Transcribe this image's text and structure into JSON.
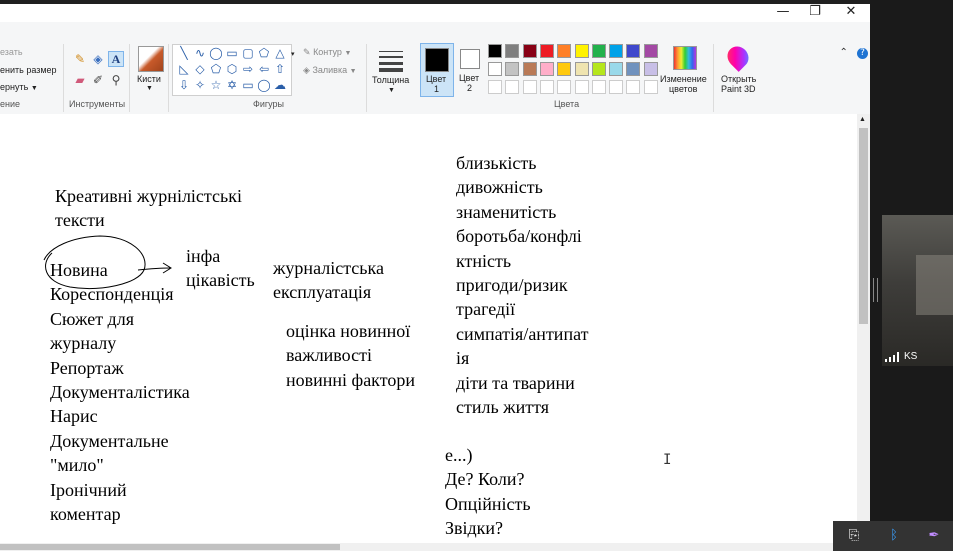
{
  "window": {
    "minimize_glyph": "—",
    "maximize_glyph": "❐",
    "close_glyph": "✕"
  },
  "ribbon": {
    "image_group": {
      "crop_label": "езать",
      "resize_label": "енить размер",
      "rotate_label": "ернуть",
      "group_label": "ение"
    },
    "tools_group": {
      "label": "Инструменты"
    },
    "brushes": {
      "label": "Кисти"
    },
    "shapes_group": {
      "label": "Фигуры",
      "outline_label": "Контур",
      "fill_label": "Заливка"
    },
    "size": {
      "label": "Толщина"
    },
    "colors": {
      "color1_label_a": "Цвет",
      "color1_label_b": "1",
      "color2_label_a": "Цвет",
      "color2_label_b": "2",
      "group_label": "Цвета",
      "color1": "#000000",
      "color2": "#ffffff",
      "palette_row1": [
        "#000000",
        "#7f7f7f",
        "#880015",
        "#ed1c24",
        "#ff7f27",
        "#fff200",
        "#22b14c",
        "#00a2e8",
        "#3f48cc",
        "#a349a4"
      ],
      "palette_row2": [
        "#ffffff",
        "#c3c3c3",
        "#b97a57",
        "#ffaec9",
        "#ffc90e",
        "#efe4b0",
        "#b5e61d",
        "#99d9ea",
        "#7092be",
        "#c8bfe7"
      ],
      "palette_row3": [
        "#ffffff",
        "#ffffff",
        "#ffffff",
        "#ffffff",
        "#ffffff",
        "#ffffff",
        "#ffffff",
        "#ffffff",
        "#ffffff",
        "#ffffff"
      ],
      "edit_colors_a": "Изменение",
      "edit_colors_b": "цветов"
    },
    "paint3d": {
      "label_a": "Открыть",
      "label_b": "Paint 3D"
    }
  },
  "canvas": {
    "heading": "Креативні журнілістські\nтексти",
    "genres": "Новина\nКореспонденція\nСюжет для\nжурналу\nРепортаж\nДокументалістика\nНарис\nДокументальне\n\"мило\"\nІронічний\nкоментар",
    "info_interest": "інфа\nцікавість",
    "exploitation": "журналістська\nексплуатація",
    "news_value": "оцінка новинної\nважливості\nновинні фактори",
    "factors": "близькість\nдивожність\nзнаменитість\nборотьба/конфлі\nктність\nпригоди/ризик\nтрагедії\nсимпатія/антипат\nія\nдіти та тварини\nстиль життя",
    "questions": "е...)\nДе? Коли?\nОпційність\nЗвідки?"
  },
  "video": {
    "participant": "KS"
  },
  "icons": {
    "help": "?",
    "cursor": "I"
  }
}
